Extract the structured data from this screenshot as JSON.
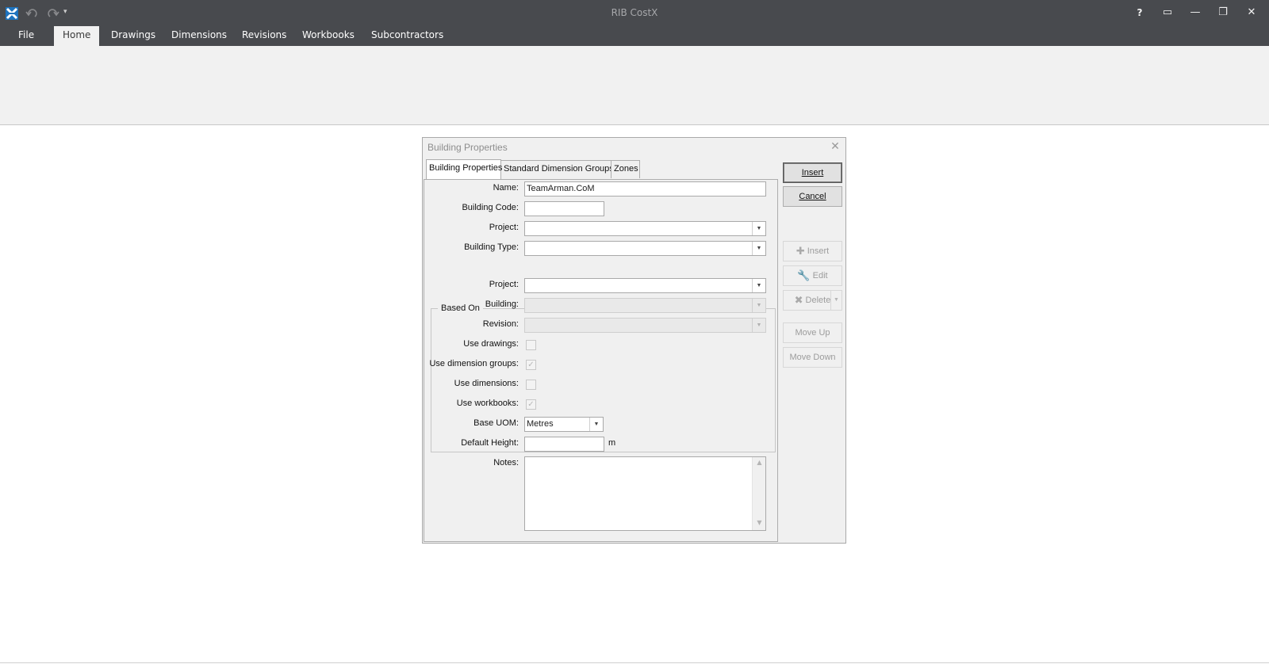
{
  "app": {
    "title": "RIB CostX",
    "logo_icon": "costx-logo-icon",
    "qat": {
      "undo_icon": "undo-icon",
      "redo_icon": "redo-icon",
      "dropdown_icon": "qat-dropdown-icon"
    },
    "window_buttons": {
      "help": "?",
      "ribbon_display": "▭",
      "minimize": "—",
      "restore": "❐",
      "close": "✕"
    }
  },
  "ribbon": {
    "tabs": [
      {
        "label": "File"
      },
      {
        "label": "Home",
        "active": true
      },
      {
        "label": "Drawings"
      },
      {
        "label": "Dimensions"
      },
      {
        "label": "Revisions"
      },
      {
        "label": "Workbooks"
      },
      {
        "label": "Subcontractors"
      }
    ]
  },
  "dialog": {
    "title": "Building Properties",
    "close": "✕",
    "tabs": [
      {
        "label": "Building Properties",
        "active": true
      },
      {
        "label": "Standard Dimension Groups"
      },
      {
        "label": "Zones"
      }
    ],
    "fields": {
      "name_label": "Name:",
      "name_value": "TeamArman.CoM",
      "building_code_label": "Building Code:",
      "building_code_value": "",
      "project_label": "Project:",
      "project_value": "",
      "building_type_label": "Building Type:",
      "building_type_value": ""
    },
    "based_on": {
      "group_label": "Based On",
      "project_label": "Project:",
      "project_value": "",
      "building_label": "Building:",
      "building_value": "",
      "revision_label": "Revision:",
      "revision_value": "",
      "use_drawings_label": "Use drawings:",
      "use_drawings_checked": false,
      "use_dimension_groups_label": "Use dimension groups:",
      "use_dimension_groups_checked": true,
      "use_dimensions_label": "Use dimensions:",
      "use_dimensions_checked": false,
      "use_workbooks_label": "Use workbooks:",
      "use_workbooks_checked": true
    },
    "base_uom_label": "Base UOM:",
    "base_uom_value": "Metres",
    "default_height_label": "Default Height:",
    "default_height_value": "",
    "default_height_unit": "m",
    "notes_label": "Notes:",
    "notes_value": "",
    "buttons": {
      "insert_main": "Insert",
      "cancel": "Cancel",
      "insert": "Insert",
      "edit": "Edit",
      "delete": "Delete",
      "move_up": "Move Up",
      "move_down": "Move Down"
    }
  },
  "colors": {
    "titlebar": "#484a4e",
    "ribbon_body": "#f1f1f1",
    "dialog_bg": "#f0f0f0"
  }
}
